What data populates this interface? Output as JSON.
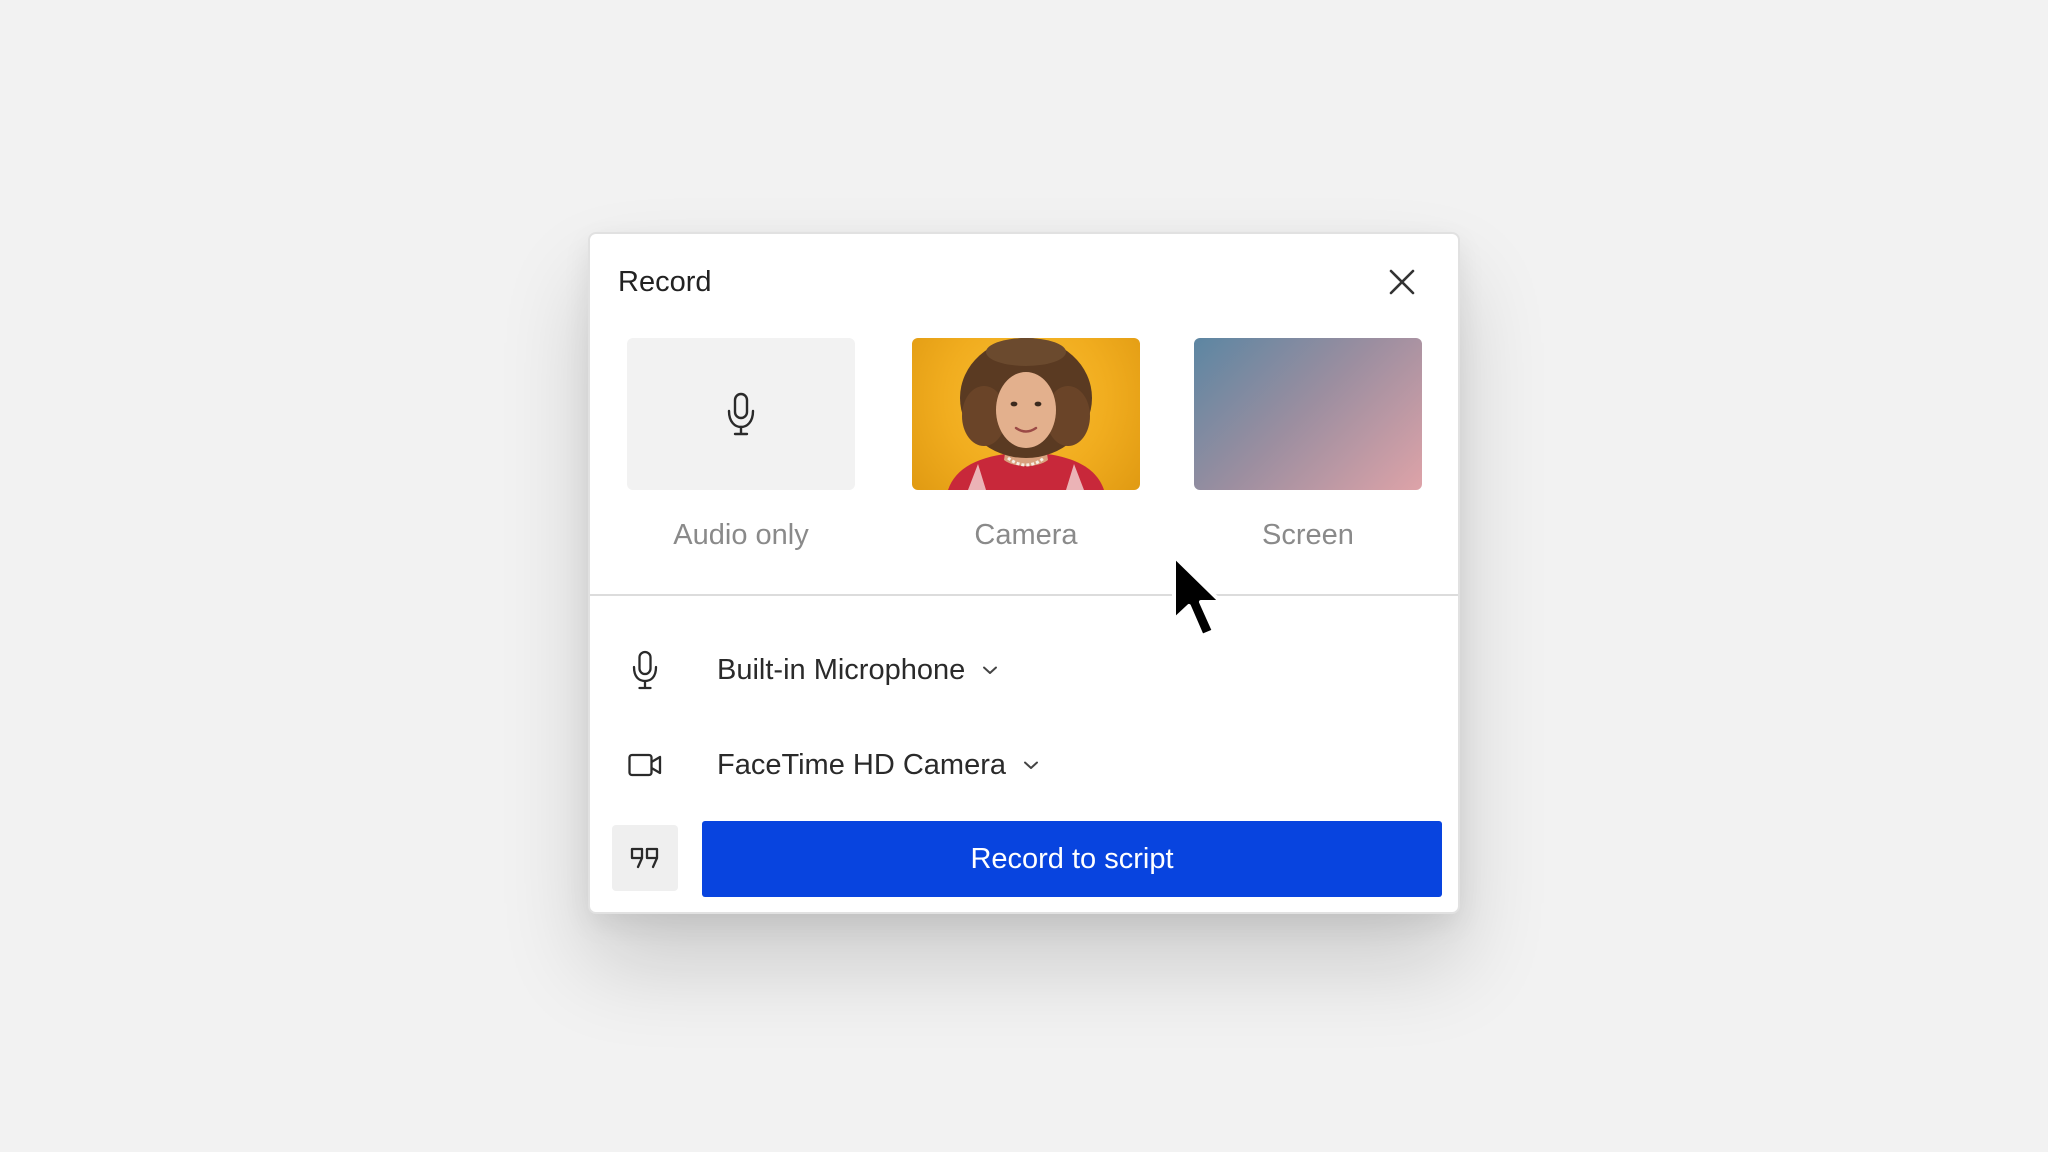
{
  "dialog": {
    "title": "Record"
  },
  "options": [
    {
      "label": "Audio only",
      "icon": "microphone-icon"
    },
    {
      "label": "Camera",
      "icon": "camera-preview"
    },
    {
      "label": "Screen",
      "icon": "screen-preview"
    }
  ],
  "devices": {
    "microphone": {
      "name": "Built-in Microphone",
      "icon": "microphone-icon"
    },
    "camera": {
      "name": "FaceTime HD Camera",
      "icon": "video-camera-icon"
    }
  },
  "actions": {
    "script_icon": "quote-icon",
    "record_label": "Record to script"
  },
  "colors": {
    "background": "#f2f2f2",
    "primary": "#0844df",
    "camera_bg": "#f1ad1f",
    "screen_gradient_start": "#5c86a2",
    "screen_gradient_end": "#dea3a8"
  }
}
